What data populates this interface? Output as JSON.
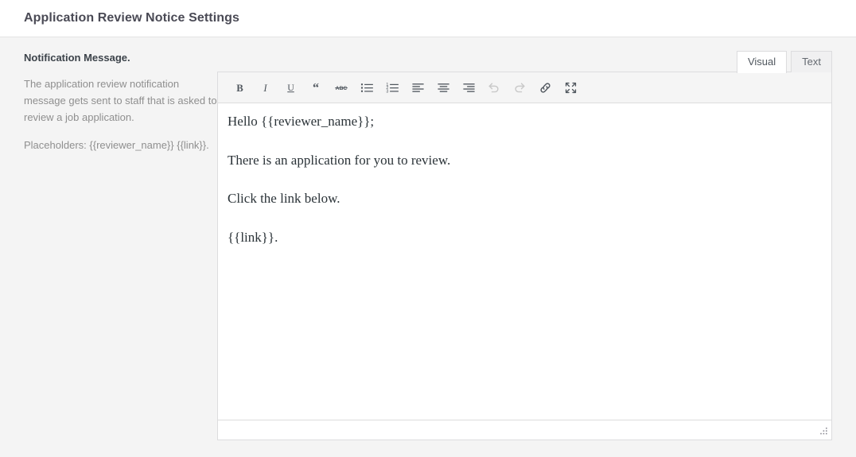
{
  "header": {
    "title": "Application Review Notice Settings"
  },
  "field": {
    "label": "Notification Message.",
    "help": "The application review notification message gets sent to staff that is asked to review a job application.",
    "placeholders": "Placeholders: {{reviewer_name}} {{link}}."
  },
  "editor": {
    "tabs": [
      {
        "label": "Visual",
        "active": true
      },
      {
        "label": "Text",
        "active": false
      }
    ],
    "toolbar": [
      {
        "name": "bold-icon",
        "title": "Bold",
        "disabled": false
      },
      {
        "name": "italic-icon",
        "title": "Italic",
        "disabled": false
      },
      {
        "name": "underline-icon",
        "title": "Underline",
        "disabled": false
      },
      {
        "name": "blockquote-icon",
        "title": "Blockquote",
        "disabled": false
      },
      {
        "name": "strikethrough-icon",
        "title": "Strikethrough",
        "disabled": false
      },
      {
        "name": "bulleted-list-icon",
        "title": "Bulleted list",
        "disabled": false
      },
      {
        "name": "numbered-list-icon",
        "title": "Numbered list",
        "disabled": false
      },
      {
        "name": "align-left-icon",
        "title": "Align left",
        "disabled": false
      },
      {
        "name": "align-center-icon",
        "title": "Align center",
        "disabled": false
      },
      {
        "name": "align-right-icon",
        "title": "Align right",
        "disabled": false
      },
      {
        "name": "undo-icon",
        "title": "Undo",
        "disabled": true
      },
      {
        "name": "redo-icon",
        "title": "Redo",
        "disabled": true
      },
      {
        "name": "link-icon",
        "title": "Insert/edit link",
        "disabled": false
      },
      {
        "name": "fullscreen-icon",
        "title": "Fullscreen",
        "disabled": false
      }
    ],
    "content": [
      "Hello {{reviewer_name}};",
      "There is an application for you to review.",
      "Click the link below.",
      "{{link}}."
    ]
  },
  "colors": {
    "page_background": "#f4f4f4",
    "header_background": "#ffffff",
    "title_text": "#4a4a55",
    "help_text": "#8f8f8f",
    "toolbar_background": "#f5f5f5",
    "icon": "#50575e",
    "icon_disabled": "#c9c9c9",
    "border": "#dcdcde"
  }
}
